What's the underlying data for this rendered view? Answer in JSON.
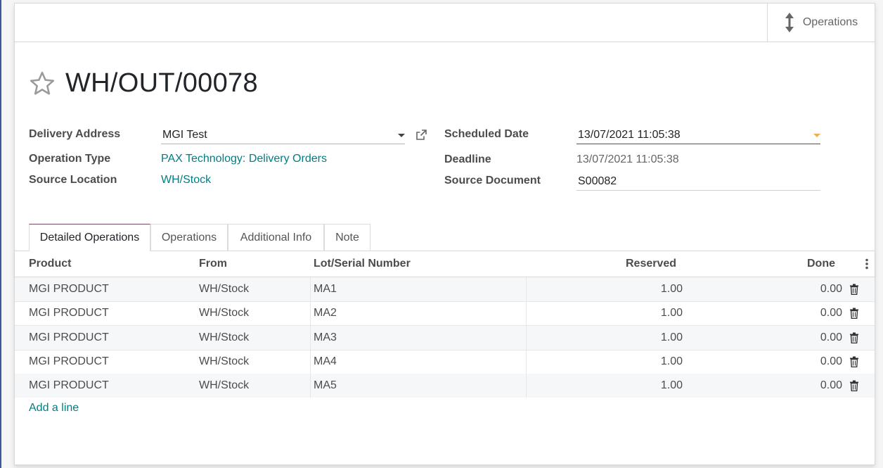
{
  "header": {
    "smart_button_label": "Operations",
    "record_title": "WH/OUT/00078"
  },
  "fields": {
    "delivery_address": {
      "label": "Delivery Address",
      "value": "MGI Test"
    },
    "operation_type": {
      "label": "Operation Type",
      "value": "PAX Technology: Delivery Orders"
    },
    "source_location": {
      "label": "Source Location",
      "value": "WH/Stock"
    },
    "scheduled_date": {
      "label": "Scheduled Date",
      "value": "13/07/2021 11:05:38"
    },
    "deadline": {
      "label": "Deadline",
      "value": "13/07/2021 11:05:38"
    },
    "source_document": {
      "label": "Source Document",
      "value": "S00082"
    }
  },
  "tabs": [
    {
      "label": "Detailed Operations",
      "active": true
    },
    {
      "label": "Operations",
      "active": false
    },
    {
      "label": "Additional Info",
      "active": false
    },
    {
      "label": "Note",
      "active": false
    }
  ],
  "table": {
    "columns": [
      "Product",
      "From",
      "Lot/Serial Number",
      "Reserved",
      "Done"
    ],
    "rows": [
      {
        "product": "MGI PRODUCT",
        "from": "WH/Stock",
        "lot": "MA1",
        "reserved": "1.00",
        "done": "0.00"
      },
      {
        "product": "MGI PRODUCT",
        "from": "WH/Stock",
        "lot": "MA2",
        "reserved": "1.00",
        "done": "0.00"
      },
      {
        "product": "MGI PRODUCT",
        "from": "WH/Stock",
        "lot": "MA3",
        "reserved": "1.00",
        "done": "0.00"
      },
      {
        "product": "MGI PRODUCT",
        "from": "WH/Stock",
        "lot": "MA4",
        "reserved": "1.00",
        "done": "0.00"
      },
      {
        "product": "MGI PRODUCT",
        "from": "WH/Stock",
        "lot": "MA5",
        "reserved": "1.00",
        "done": "0.00"
      }
    ],
    "add_line_label": "Add a line"
  },
  "icons": {
    "smart_button": "vertical-arrows-icon",
    "favorite": "star-outline-icon",
    "external_link": "external-link-icon",
    "dropdown": "caret-down-icon",
    "row_delete": "trash-icon",
    "optional_columns": "kebab-icon"
  },
  "colors": {
    "link": "#017e84",
    "accent_tab": "#714b67",
    "date_caret": "#f0ad4e"
  }
}
